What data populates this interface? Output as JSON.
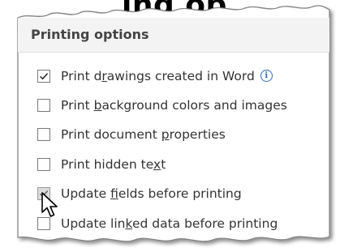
{
  "heading_fragment": "ing op",
  "section": {
    "title": "Printing options"
  },
  "options": [
    {
      "pre": "Print d",
      "key": "r",
      "post": "awings created in Word",
      "checked": true,
      "info": true
    },
    {
      "pre": "Print ",
      "key": "b",
      "post": "ackground colors and images",
      "checked": false
    },
    {
      "pre": "Print document ",
      "key": "p",
      "post": "roperties",
      "checked": false
    },
    {
      "pre": "Print hidden te",
      "key": "x",
      "post": "t",
      "checked": false
    },
    {
      "pre": "Update ",
      "key": "f",
      "post": "ields before printing",
      "checked": true,
      "pressed": true
    },
    {
      "pre": "Update lin",
      "key": "k",
      "post": "ed data before printing",
      "checked": false
    }
  ],
  "info_icon_glyph": "i",
  "icons": {
    "info": "info-icon",
    "cursor": "arrow-cursor-icon",
    "check": "checkmark-icon"
  },
  "colors": {
    "header_bg": "#f3f3f3",
    "text": "#333333",
    "info": "#2b6cc4",
    "border": "#7a7a7a"
  }
}
